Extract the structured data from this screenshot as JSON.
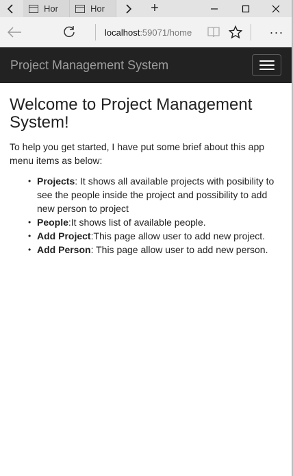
{
  "browser": {
    "tabs": [
      {
        "label": "Hor"
      },
      {
        "label": "Hor"
      }
    ],
    "new_tab_symbol": "+",
    "more_symbol": "···",
    "address": {
      "host": "localhost",
      "rest": ":59071/home"
    },
    "icons": [
      "back-arrow-icon",
      "refresh-icon",
      "reading-view-icon",
      "favorite-star-icon",
      "more-icon",
      "minimize-icon",
      "maximize-icon",
      "close-icon"
    ]
  },
  "navbar": {
    "brand": "Project Management System",
    "background": "#222222",
    "brand_color": "#9d9d9d"
  },
  "main": {
    "heading": "Welcome to Project Management System!",
    "intro": "To help you get started, I have put some brief about this app menu items as below:",
    "items": [
      {
        "title": "Projects",
        "text": ": It shows all available projects with posibility to see the people inside the project and possibility to add new person to project"
      },
      {
        "title": "People",
        "text": ":It shows list of available people."
      },
      {
        "title": "Add Project",
        "text": ":This page allow user to add new project."
      },
      {
        "title": "Add Person",
        "text": ": This page allow user to add new person."
      }
    ]
  }
}
